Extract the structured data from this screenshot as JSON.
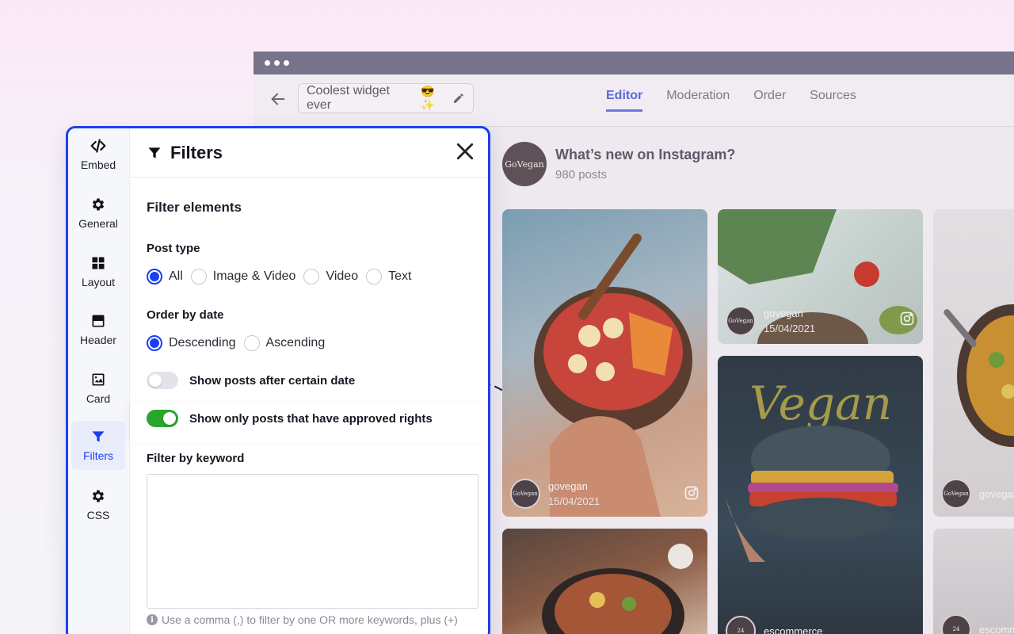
{
  "window": {
    "widget_title": "Coolest widget ever",
    "widget_emoji": "😎✨",
    "tabs": [
      {
        "label": "Editor",
        "active": true
      },
      {
        "label": "Moderation",
        "active": false
      },
      {
        "label": "Order",
        "active": false
      },
      {
        "label": "Sources",
        "active": false
      }
    ],
    "feed": {
      "title": "What’s new on Instagram?",
      "count": "980 posts",
      "brand_avatar": "GoVegan"
    },
    "posts": [
      {
        "username": "govegan",
        "date": "15/04/2021"
      },
      {
        "username": "govegan",
        "date": "15/04/2021"
      },
      {
        "username": "escommerce",
        "date": ""
      },
      {
        "username": "govegan",
        "date": ""
      },
      {
        "username": "escommerce",
        "date": ""
      }
    ]
  },
  "panel": {
    "title": "Filters",
    "rail": [
      {
        "label": "Embed",
        "icon": "code-icon"
      },
      {
        "label": "General",
        "icon": "gear-icon"
      },
      {
        "label": "Layout",
        "icon": "grid-icon"
      },
      {
        "label": "Header",
        "icon": "header-icon"
      },
      {
        "label": "Card",
        "icon": "image-icon"
      },
      {
        "label": "Filters",
        "icon": "funnel-icon",
        "active": true
      },
      {
        "label": "CSS",
        "icon": "gear-icon"
      }
    ],
    "section_title": "Filter elements",
    "post_type": {
      "label": "Post type",
      "options": [
        "All",
        "Image & Video",
        "Video",
        "Text"
      ],
      "selected": "All"
    },
    "order": {
      "label": "Order by date",
      "options": [
        "Descending",
        "Ascending"
      ],
      "selected": "Descending"
    },
    "toggles": {
      "after_date": {
        "label": "Show posts after certain date",
        "on": false
      },
      "approved_rights": {
        "label": "Show only posts that have approved rights",
        "on": true
      }
    },
    "keyword": {
      "label": "Filter by keyword",
      "value": "",
      "hint": "Use a comma (,) to filter by one OR more keywords, plus (+)"
    }
  },
  "colors": {
    "accent": "#1b3ff0",
    "toggle_on": "#2aa52e",
    "tab_active": "#5b68d9"
  }
}
